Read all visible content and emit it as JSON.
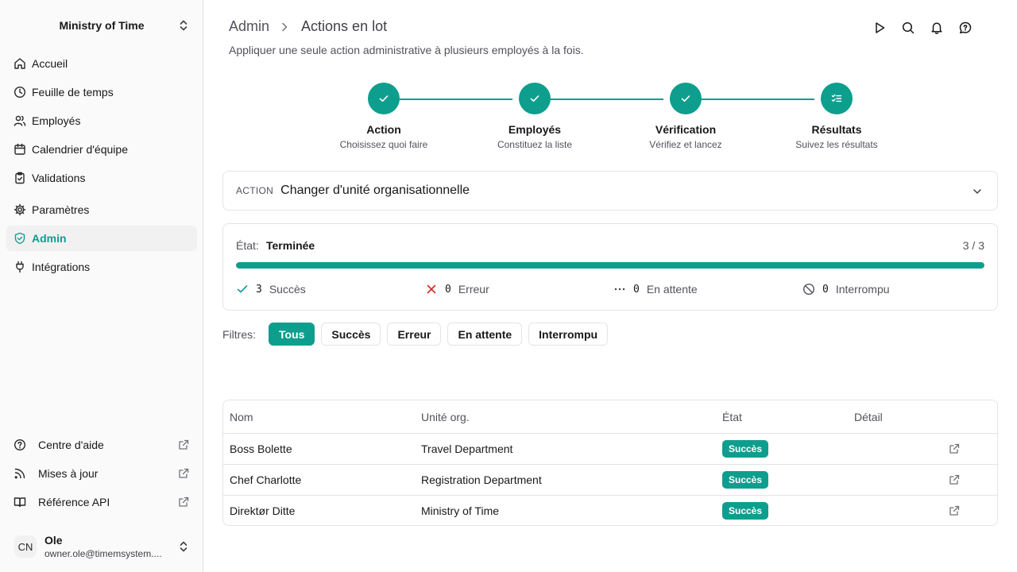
{
  "sidebar": {
    "org_name": "Ministry of Time",
    "nav": [
      {
        "label": "Accueil",
        "icon": "home-icon"
      },
      {
        "label": "Feuille de temps",
        "icon": "clock-icon"
      },
      {
        "label": "Employés",
        "icon": "users-icon"
      },
      {
        "label": "Calendrier d'équipe",
        "icon": "calendar-icon"
      },
      {
        "label": "Validations",
        "icon": "clipboard-check-icon"
      },
      {
        "label": "Paramètres",
        "icon": "gear-icon"
      },
      {
        "label": "Admin",
        "icon": "shield-check-icon",
        "active": true
      },
      {
        "label": "Intégrations",
        "icon": "plug-icon"
      }
    ],
    "footer": [
      {
        "label": "Centre d'aide",
        "icon": "help-circle-icon"
      },
      {
        "label": "Mises à jour",
        "icon": "rss-icon"
      },
      {
        "label": "Référence API",
        "icon": "book-icon"
      }
    ],
    "user": {
      "initials": "CN",
      "name": "Ole",
      "email": "owner.ole@timemsystem...."
    }
  },
  "header": {
    "breadcrumb_root": "Admin",
    "breadcrumb_current": "Actions en lot",
    "subtitle": "Appliquer une seule action administrative à plusieurs employés à la fois.",
    "icons": [
      "play-icon",
      "search-icon",
      "bell-icon",
      "chat-help-icon"
    ]
  },
  "steps": [
    {
      "title": "Action",
      "desc": "Choisissez quoi faire",
      "state": "done"
    },
    {
      "title": "Employés",
      "desc": "Constituez la liste",
      "state": "done"
    },
    {
      "title": "Vérification",
      "desc": "Vérifiez et lancez",
      "state": "done"
    },
    {
      "title": "Résultats",
      "desc": "Suivez les résultats",
      "state": "current"
    }
  ],
  "action": {
    "label": "ACTION",
    "value": "Changer d'unité organisationnelle"
  },
  "status": {
    "label": "État:",
    "value": "Terminée",
    "count": "3 / 3",
    "progress": 1.0,
    "stats": [
      {
        "num": "3",
        "label": "Succès",
        "icon": "check-icon"
      },
      {
        "num": "0",
        "label": "Erreur",
        "icon": "x-icon"
      },
      {
        "num": "0",
        "label": "En attente",
        "icon": "ellipsis-icon"
      },
      {
        "num": "0",
        "label": "Interrompu",
        "icon": "ban-icon"
      }
    ]
  },
  "filters": {
    "label": "Filtres:",
    "options": [
      "Tous",
      "Succès",
      "Erreur",
      "En attente",
      "Interrompu"
    ],
    "selected": "Tous"
  },
  "table": {
    "columns": [
      "Nom",
      "Unité org.",
      "État",
      "Détail"
    ],
    "rows": [
      {
        "name": "Boss Bolette",
        "unit": "Travel Department",
        "status": "Succès"
      },
      {
        "name": "Chef Charlotte",
        "unit": "Registration Department",
        "status": "Succès"
      },
      {
        "name": "Direktør Ditte",
        "unit": "Ministry of Time",
        "status": "Succès"
      }
    ]
  },
  "colors": {
    "accent": "#0e9e8e",
    "error": "#dc2626"
  }
}
